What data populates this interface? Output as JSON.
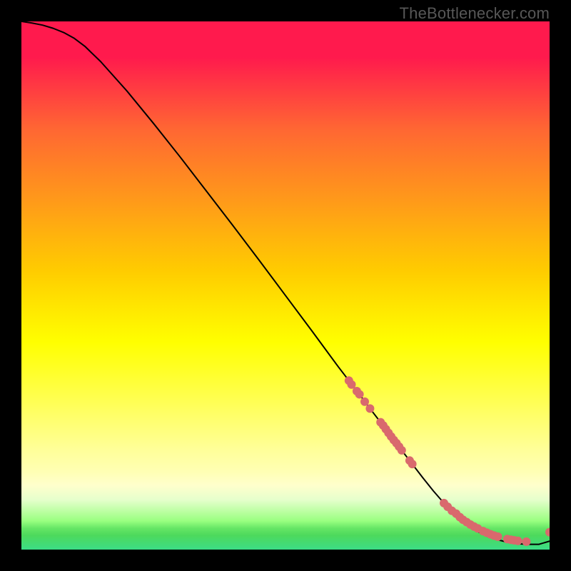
{
  "watermark": "TheBottlenecker.com",
  "chart_data": {
    "type": "line",
    "title": "",
    "xlabel": "",
    "ylabel": "",
    "xlim": [
      0,
      100
    ],
    "ylim": [
      0,
      100
    ],
    "grid": false,
    "series": [
      {
        "name": "curve",
        "style": "line",
        "color": "#000000",
        "x": [
          0,
          2,
          4,
          6,
          8,
          10,
          12,
          15,
          20,
          25,
          30,
          35,
          40,
          45,
          50,
          55,
          60,
          62,
          64,
          66,
          68,
          70,
          72,
          74,
          76,
          78,
          80,
          82,
          84,
          86,
          88,
          90,
          92,
          94,
          96,
          98,
          100
        ],
        "y": [
          100,
          99.7,
          99.3,
          98.7,
          97.9,
          96.8,
          95.3,
          92.4,
          86.8,
          80.7,
          74.4,
          67.9,
          61.4,
          54.8,
          48.1,
          41.4,
          34.6,
          32.0,
          29.4,
          26.7,
          24.1,
          21.4,
          18.8,
          16.2,
          13.6,
          11.1,
          8.8,
          6.7,
          5.0,
          3.6,
          2.6,
          1.9,
          1.4,
          1.1,
          1.0,
          1.0,
          1.6
        ]
      },
      {
        "name": "scatter",
        "style": "points",
        "color": "#d9696d",
        "x": [
          62.0,
          62.5,
          63.5,
          64.0,
          65.0,
          66.0,
          68.0,
          68.5,
          69.0,
          69.5,
          70.0,
          70.5,
          71.0,
          71.5,
          72.0,
          73.5,
          74.0,
          80.0,
          80.7,
          81.5,
          82.3,
          83.0,
          83.6,
          84.3,
          85.0,
          85.7,
          86.4,
          87.4,
          88.1,
          88.8,
          89.5,
          90.2,
          92.0,
          92.7,
          93.3,
          94.0,
          95.6,
          100.0
        ],
        "y": [
          32.0,
          31.25,
          30.0,
          29.4,
          28.0,
          26.7,
          24.1,
          23.5,
          22.8,
          22.1,
          21.4,
          20.75,
          20.15,
          19.5,
          18.8,
          16.85,
          16.2,
          8.8,
          8.1,
          7.35,
          6.8,
          6.15,
          5.65,
          5.2,
          4.75,
          4.35,
          4.0,
          3.5,
          3.2,
          2.9,
          2.65,
          2.45,
          2.0,
          1.85,
          1.75,
          1.65,
          1.5,
          3.3
        ]
      }
    ],
    "gradient_stops": [
      {
        "pct": 0.0,
        "color": "#ff1a4d"
      },
      {
        "pct": 6.76,
        "color": "#ff1a4d"
      },
      {
        "pct": 13.51,
        "color": "#ff4040"
      },
      {
        "pct": 20.27,
        "color": "#ff6633"
      },
      {
        "pct": 27.03,
        "color": "#ff8026"
      },
      {
        "pct": 33.78,
        "color": "#ff991a"
      },
      {
        "pct": 40.54,
        "color": "#ffb30d"
      },
      {
        "pct": 47.3,
        "color": "#ffcc00"
      },
      {
        "pct": 54.05,
        "color": "#ffe600"
      },
      {
        "pct": 60.81,
        "color": "#ffff00"
      },
      {
        "pct": 67.57,
        "color": "#ffff33"
      },
      {
        "pct": 74.32,
        "color": "#ffff66"
      },
      {
        "pct": 81.08,
        "color": "#ffff99"
      },
      {
        "pct": 85.14,
        "color": "#ffffb3"
      },
      {
        "pct": 87.84,
        "color": "#ffffcc"
      },
      {
        "pct": 90.54,
        "color": "#e6ffcc"
      },
      {
        "pct": 91.89,
        "color": "#ccffb3"
      },
      {
        "pct": 93.24,
        "color": "#b3ff99"
      },
      {
        "pct": 94.59,
        "color": "#99ff80"
      },
      {
        "pct": 95.95,
        "color": "#66e666"
      },
      {
        "pct": 97.3,
        "color": "#4dd95c"
      },
      {
        "pct": 100.0,
        "color": "#3cdc86"
      }
    ]
  }
}
